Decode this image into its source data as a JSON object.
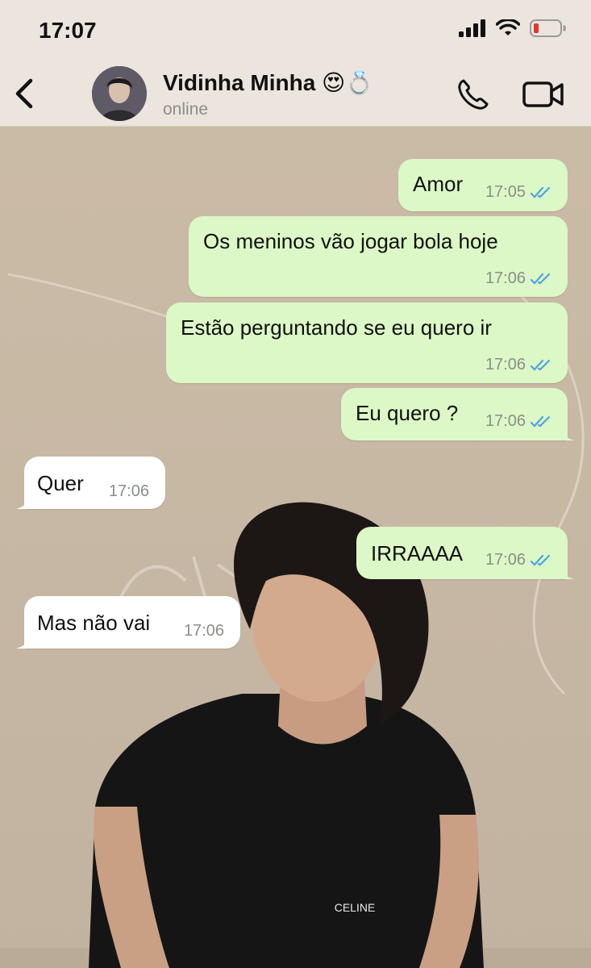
{
  "status_bar": {
    "time": "17:07"
  },
  "header": {
    "contact_name": "Vidinha Minha 😍💍",
    "contact_status": "online",
    "icons": [
      "back-icon",
      "phone-icon",
      "video-call-icon"
    ]
  },
  "messages": [
    {
      "direction": "out",
      "text": "Amor",
      "time": "17:05",
      "status": "read"
    },
    {
      "direction": "out",
      "text": "Os meninos vão jogar bola hoje",
      "time": "17:06",
      "status": "read"
    },
    {
      "direction": "out",
      "text": "Estão perguntando se eu quero ir",
      "time": "17:06",
      "status": "read"
    },
    {
      "direction": "out",
      "text": "Eu quero ?",
      "time": "17:06",
      "status": "read"
    },
    {
      "direction": "in",
      "text": "Quer",
      "time": "17:06"
    },
    {
      "direction": "out",
      "text": "IRRAAAA",
      "time": "17:06",
      "status": "read"
    },
    {
      "direction": "in",
      "text": "Mas não vai",
      "time": "17:06"
    }
  ],
  "wallpaper": {
    "shirt_print": "CELINE"
  },
  "colors": {
    "outgoing_bubble": "#dcf8c6",
    "incoming_bubble": "#ffffff",
    "header_bg": "#ece5dd",
    "read_ticks": "#4fa3e0"
  }
}
